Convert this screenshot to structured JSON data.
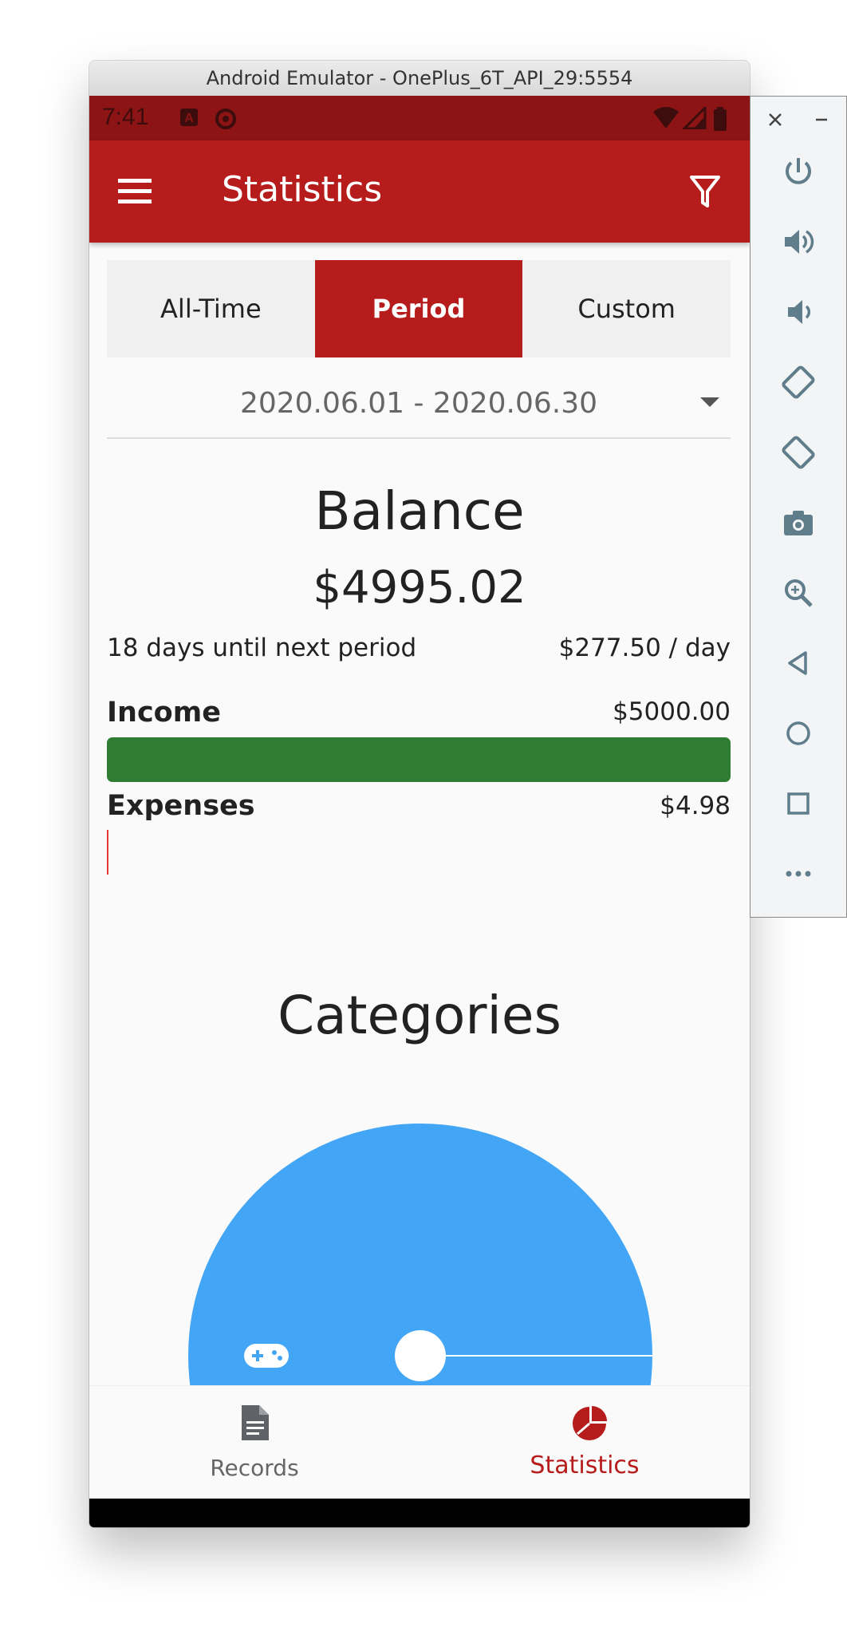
{
  "window": {
    "title": "Android Emulator - OnePlus_6T_API_29:5554"
  },
  "status_bar": {
    "time": "7:41"
  },
  "app_bar": {
    "title": "Statistics",
    "menu_icon": "hamburger-menu-icon",
    "filter_icon": "filter-icon"
  },
  "period_tabs": {
    "items": [
      "All-Time",
      "Period",
      "Custom"
    ],
    "selected": "Period"
  },
  "date_range": {
    "value": "2020.06.01 - 2020.06.30"
  },
  "balance": {
    "title": "Balance",
    "value": "$4995.02",
    "days_left": "18 days until next period",
    "per_day": "$277.50 / day"
  },
  "income": {
    "label": "Income",
    "value": "$5000.00",
    "fraction": 1.0,
    "color": "#2e7d32"
  },
  "expenses": {
    "label": "Expenses",
    "value": "$4.98",
    "fraction": 0.001,
    "color": "#e53935"
  },
  "categories": {
    "title": "Categories",
    "slice_color": "#42a5f5",
    "slice_icon": "gamepad-icon"
  },
  "bottom_nav": {
    "items": [
      {
        "label": "Records",
        "icon": "document-icon",
        "active": false
      },
      {
        "label": "Statistics",
        "icon": "pie-chart-icon",
        "active": true
      }
    ]
  },
  "colors": {
    "primary": "#b71c1c",
    "status_bar": "#8c1414",
    "income": "#2e7d32",
    "chart": "#42a5f5"
  },
  "emulator_controls": [
    "close-icon",
    "minimize-icon",
    "power-icon",
    "volume-up-icon",
    "volume-down-icon",
    "rotate-left-icon",
    "rotate-right-icon",
    "camera-icon",
    "zoom-icon",
    "back-icon",
    "home-icon",
    "overview-icon",
    "more-icon"
  ]
}
